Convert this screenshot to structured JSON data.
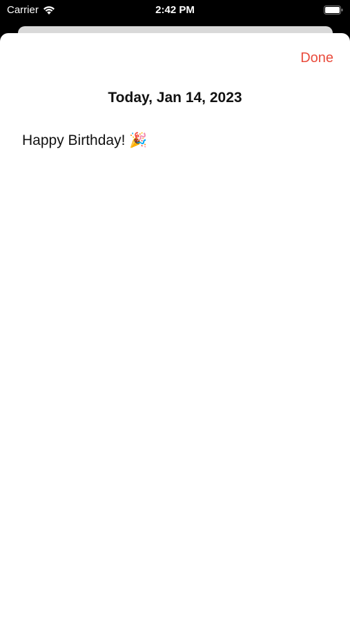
{
  "status_bar": {
    "carrier": "Carrier",
    "time": "2:42 PM",
    "wifi_icon": "wifi-icon",
    "battery_icon": "battery-icon"
  },
  "sheet": {
    "done_label": "Done",
    "date_title": "Today, Jan 14, 2023",
    "entry_text": "Happy Birthday! 🎉"
  },
  "colors": {
    "accent": "#e94b3c",
    "background": "#000000",
    "sheet": "#ffffff"
  }
}
